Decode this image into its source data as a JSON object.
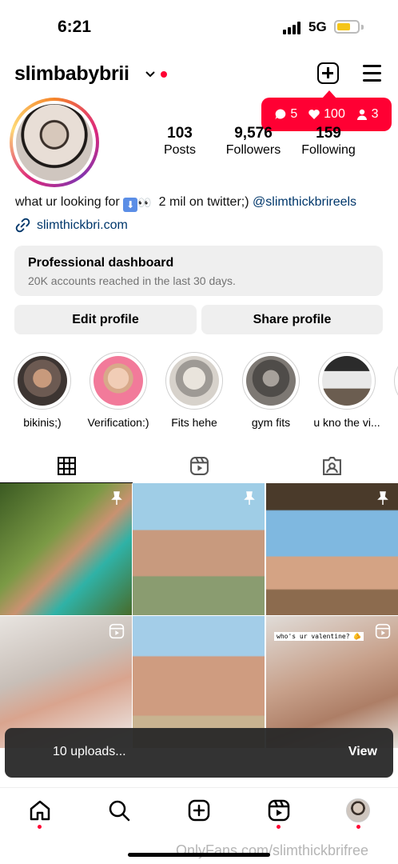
{
  "status_bar": {
    "time": "6:21",
    "network": "5G"
  },
  "header": {
    "username": "slimbabybrii"
  },
  "notifications": {
    "comments": "5",
    "likes": "100",
    "followers": "3"
  },
  "stats": [
    {
      "num": "103",
      "label": "Posts"
    },
    {
      "num": "9,576",
      "label": "Followers"
    },
    {
      "num": "159",
      "label": "Following"
    }
  ],
  "bio": {
    "text_before": "what ur looking for",
    "text_after": "2 mil on twitter;)",
    "mention": "@slimthickbrireels",
    "website": "slimthickbri.com"
  },
  "dashboard": {
    "title": "Professional dashboard",
    "subtitle": "20K accounts reached in the last 30 days."
  },
  "buttons": {
    "edit": "Edit profile",
    "share": "Share profile"
  },
  "highlights": [
    {
      "label": "bikinis;)"
    },
    {
      "label": "Verification:)"
    },
    {
      "label": "Fits hehe"
    },
    {
      "label": "gym fits"
    },
    {
      "label": "u kno the vi..."
    }
  ],
  "grid_caption": "who's ur valentine? 🫵",
  "toast": {
    "message": "10 uploads...",
    "action": "View"
  },
  "watermark": "OnlyFans.com/slimthickbrifree",
  "colors": {
    "accent_red": "#ff0033",
    "link_blue": "#00376b",
    "battery_yellow": "#f5c518"
  }
}
